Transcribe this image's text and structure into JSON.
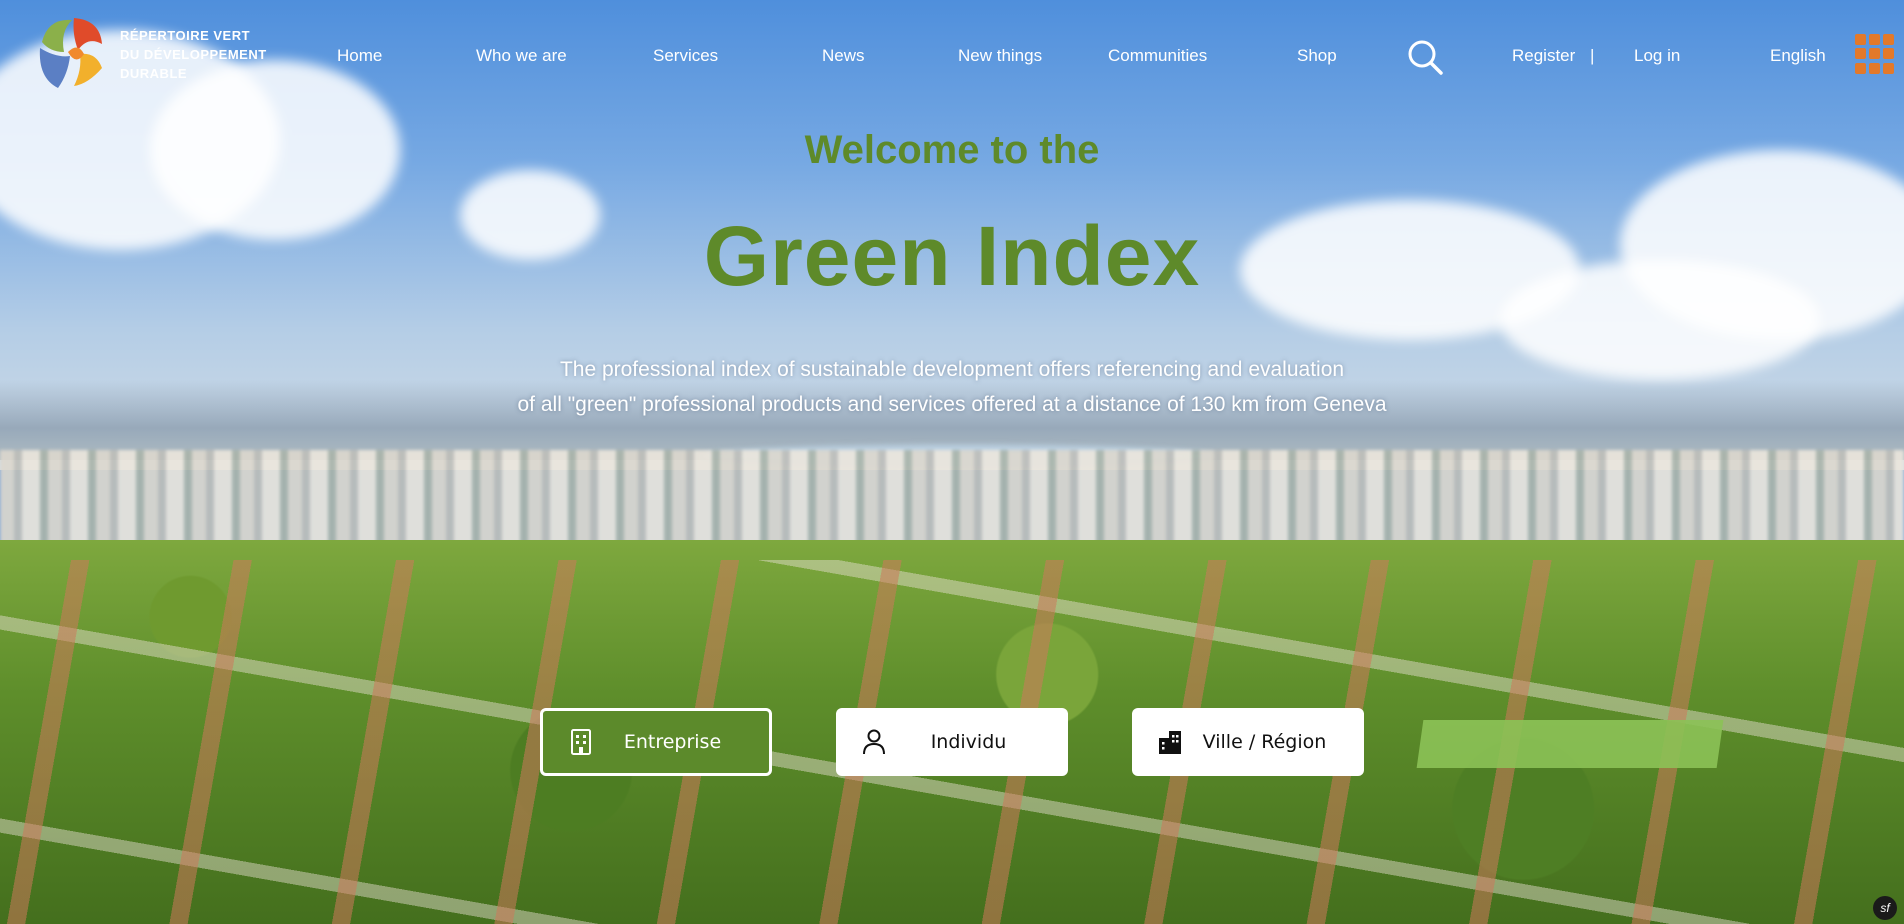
{
  "logo": {
    "lines": [
      "RÉPERTOIRE VERT",
      "DU DÉVELOPPEMENT",
      "DURABLE"
    ]
  },
  "nav": {
    "items": [
      {
        "label": "Home"
      },
      {
        "label": "Who we are"
      },
      {
        "label": "Services"
      },
      {
        "label": "News"
      },
      {
        "label": "New things"
      },
      {
        "label": "Communities"
      },
      {
        "label": "Shop"
      }
    ],
    "register": "Register",
    "separator": "|",
    "login": "Log in",
    "language": "English"
  },
  "hero": {
    "welcome": "Welcome to the",
    "title": "Green Index",
    "description_line1": "The professional index of sustainable development offers referencing and evaluation",
    "description_line2": "of all \"green\" professional products and services offered at a distance of 130 km from Geneva"
  },
  "categories": [
    {
      "label": "Entreprise",
      "icon": "building-icon",
      "selected": true
    },
    {
      "label": "Individu",
      "icon": "person-icon",
      "selected": false
    },
    {
      "label": "Ville / Région",
      "icon": "city-icon",
      "selected": false
    }
  ],
  "colors": {
    "accent_green": "#5e8a2a",
    "menu_orange": "#e3792a"
  },
  "debug_badge": "sf"
}
